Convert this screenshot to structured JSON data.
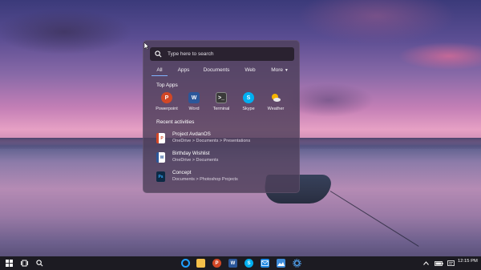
{
  "start_menu": {
    "search": {
      "placeholder": "Type here to search"
    },
    "tabs": [
      {
        "label": "All",
        "active": true
      },
      {
        "label": "Apps"
      },
      {
        "label": "Documents"
      },
      {
        "label": "Web"
      },
      {
        "label": "More",
        "icon": "caret-down-icon"
      }
    ],
    "top_apps_title": "Top Apps",
    "top_apps": [
      {
        "label": "Powerpoint",
        "icon": "powerpoint-icon",
        "color": "#d24726"
      },
      {
        "label": "Word",
        "icon": "word-icon",
        "color": "#2b579a"
      },
      {
        "label": "Terminal",
        "icon": "terminal-icon",
        "color": "#3a3a3a"
      },
      {
        "label": "Skype",
        "icon": "skype-icon",
        "color": "#00aff0"
      },
      {
        "label": "Weather",
        "icon": "weather-icon",
        "color": "#f5b400"
      }
    ],
    "recent_title": "Recent activities",
    "recent": [
      {
        "title": "Project AvdanOS",
        "path": "OneDrive > Documents > Presentations",
        "icon": "powerpoint-file-icon",
        "color": "#d24726"
      },
      {
        "title": "Birthday Wishlist",
        "path": "OneDrive > Documents",
        "icon": "word-file-icon",
        "color": "#2b579a"
      },
      {
        "title": "Concept",
        "path": "Documents > Photoshop Projects",
        "icon": "photoshop-file-icon",
        "color": "#0d2a45",
        "badge": "Ps"
      }
    ]
  },
  "taskbar": {
    "left": [
      {
        "name": "start-button",
        "icon": "windows-logo-icon"
      },
      {
        "name": "task-view-button",
        "icon": "task-view-icon"
      },
      {
        "name": "search-button",
        "icon": "search-icon"
      }
    ],
    "apps": [
      {
        "name": "cortana",
        "icon": "cortana-icon",
        "color": "#1ea0ff"
      },
      {
        "name": "file-explorer",
        "icon": "folder-icon",
        "color": "#f5c04a"
      },
      {
        "name": "powerpoint",
        "icon": "powerpoint-icon",
        "color": "#d24726"
      },
      {
        "name": "word",
        "icon": "word-icon",
        "color": "#2b579a"
      },
      {
        "name": "skype",
        "icon": "skype-icon",
        "color": "#00aff0"
      },
      {
        "name": "mail",
        "icon": "mail-icon",
        "color": "#1e88e5"
      },
      {
        "name": "photos",
        "icon": "photos-icon",
        "color": "#3d8bd8"
      },
      {
        "name": "settings",
        "icon": "gear-icon",
        "color": "#4f9de8"
      }
    ],
    "tray": [
      {
        "icon": "chevron-up-icon"
      },
      {
        "icon": "battery-icon"
      },
      {
        "icon": "notification-icon"
      }
    ],
    "clock": "12:15 PM"
  }
}
